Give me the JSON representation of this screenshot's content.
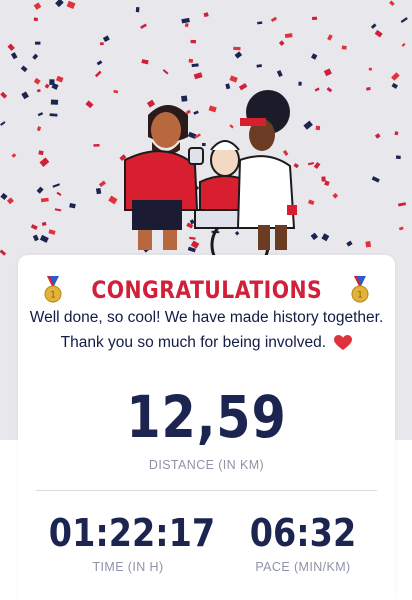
{
  "hero": {
    "illustration": "three runners celebrating with confetti"
  },
  "card": {
    "title": "CONGRATULATIONS",
    "message_line1": "Well done, so cool! We have made history together.",
    "message_line2": "Thank you so much for being involved.",
    "icons": {
      "left": "medal-icon",
      "right": "medal-icon",
      "end": "heart-icon"
    },
    "distance": {
      "value": "12,59",
      "label": "DISTANCE (IN KM)"
    },
    "time": {
      "value": "01:22:17",
      "label": "TIME (IN H)"
    },
    "pace": {
      "value": "06:32",
      "label": "PACE (MIN/KM)"
    }
  },
  "colors": {
    "accent": "#d1213a",
    "navy": "#1c2550",
    "muted": "#8f93a6",
    "hero_bg": "#e8e8ec"
  }
}
